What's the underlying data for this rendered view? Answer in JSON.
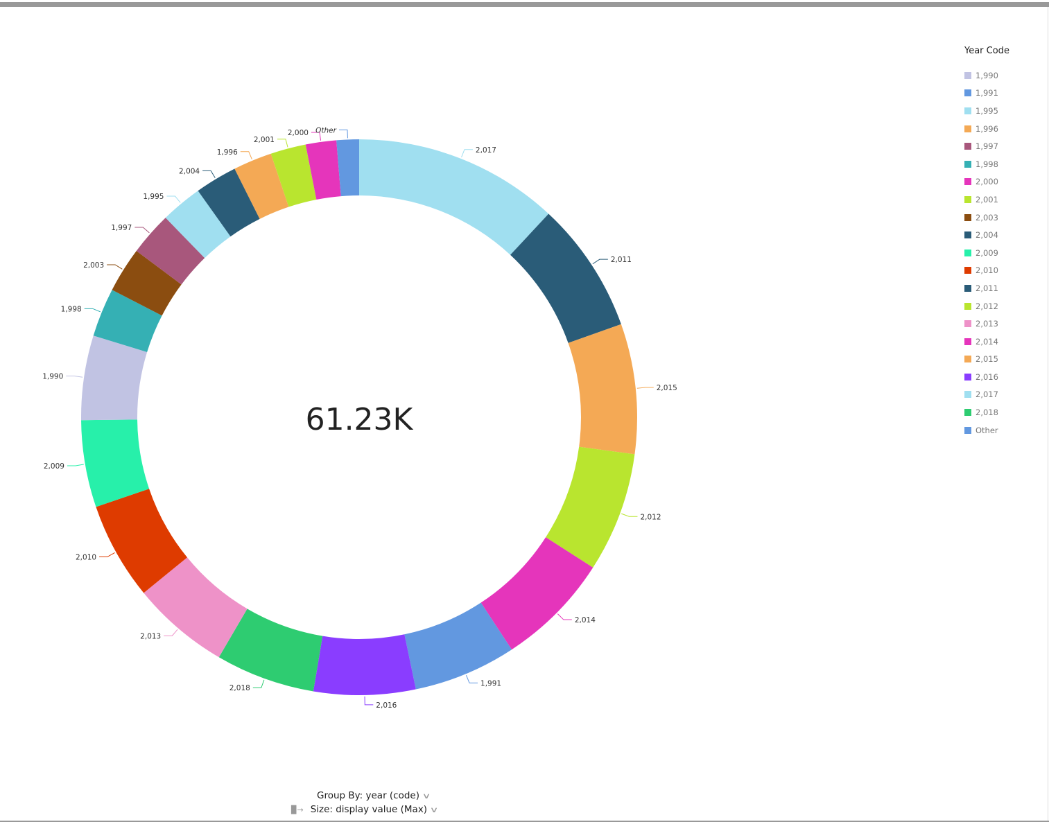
{
  "chart_data": {
    "type": "pie",
    "subtype": "donut",
    "center_label": "61.23K",
    "total": 61230,
    "slices": [
      {
        "label": "2,017",
        "value": 7310,
        "color": "#a0dff0"
      },
      {
        "label": "2,011",
        "value": 4680,
        "color": "#2a5c78"
      },
      {
        "label": "2,015",
        "value": 4630,
        "color": "#f4a955"
      },
      {
        "label": "2,012",
        "value": 4270,
        "color": "#b9e52f"
      },
      {
        "label": "2,014",
        "value": 4080,
        "color": "#e535bb"
      },
      {
        "label": "1,991",
        "value": 3660,
        "color": "#6298e0"
      },
      {
        "label": "2,016",
        "value": 3620,
        "color": "#8a3dff"
      },
      {
        "label": "2,018",
        "value": 3540,
        "color": "#2ecc71"
      },
      {
        "label": "2,013",
        "value": 3490,
        "color": "#ee92c8"
      },
      {
        "label": "2,010",
        "value": 3470,
        "color": "#de3b00"
      },
      {
        "label": "2,009",
        "value": 3100,
        "color": "#27f0aa"
      },
      {
        "label": "1,990",
        "value": 3010,
        "color": "#c1c3e3"
      },
      {
        "label": "1,998",
        "value": 1735,
        "color": "#35b0b4"
      },
      {
        "label": "2,003",
        "value": 1615,
        "color": "#8b4d10"
      },
      {
        "label": "1,997",
        "value": 1550,
        "color": "#a8577c"
      },
      {
        "label": "1,995",
        "value": 1480,
        "color": "#a0dff0"
      },
      {
        "label": "2,004",
        "value": 1500,
        "color": "#2a5c78"
      },
      {
        "label": "1,996",
        "value": 1380,
        "color": "#f4a955"
      },
      {
        "label": "2,001",
        "value": 1260,
        "color": "#b9e52f"
      },
      {
        "label": "2,000",
        "value": 1090,
        "color": "#e535bb"
      },
      {
        "label": "Other",
        "value": 800,
        "color": "#6298e0"
      }
    ],
    "legend": {
      "title": "Year Code",
      "placement": "right",
      "items": [
        {
          "label": "1,990",
          "color": "#c1c3e3"
        },
        {
          "label": "1,991",
          "color": "#6298e0"
        },
        {
          "label": "1,995",
          "color": "#a0dff0"
        },
        {
          "label": "1,996",
          "color": "#f4a955"
        },
        {
          "label": "1,997",
          "color": "#a8577c"
        },
        {
          "label": "1,998",
          "color": "#35b0b4"
        },
        {
          "label": "2,000",
          "color": "#e535bb"
        },
        {
          "label": "2,001",
          "color": "#b9e52f"
        },
        {
          "label": "2,003",
          "color": "#8b4d10"
        },
        {
          "label": "2,004",
          "color": "#2a5c78"
        },
        {
          "label": "2,009",
          "color": "#27f0aa"
        },
        {
          "label": "2,010",
          "color": "#de3b00"
        },
        {
          "label": "2,011",
          "color": "#2a5c78"
        },
        {
          "label": "2,012",
          "color": "#b9e52f"
        },
        {
          "label": "2,013",
          "color": "#ee92c8"
        },
        {
          "label": "2,014",
          "color": "#e535bb"
        },
        {
          "label": "2,015",
          "color": "#f4a955"
        },
        {
          "label": "2,016",
          "color": "#8a3dff"
        },
        {
          "label": "2,017",
          "color": "#a0dff0"
        },
        {
          "label": "2,018",
          "color": "#2ecc71"
        },
        {
          "label": "Other",
          "color": "#6298e0"
        }
      ]
    }
  },
  "controls": {
    "group_by": "Group By: year (code)",
    "size": "Size: display value (Max)",
    "chevron_icon": "chevron-down-icon",
    "size_icon": "bar-sort-icon"
  }
}
